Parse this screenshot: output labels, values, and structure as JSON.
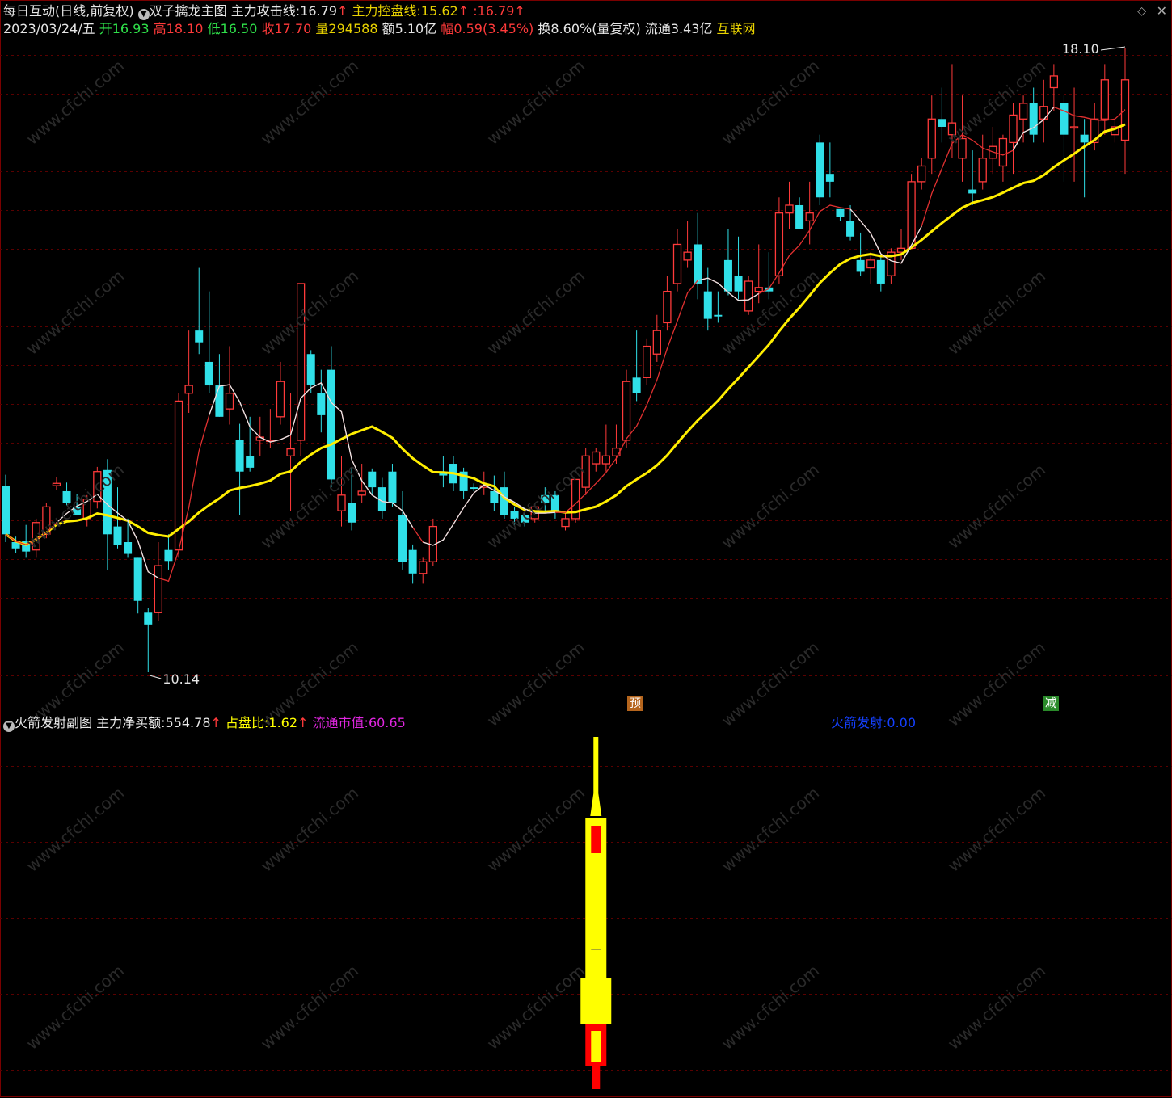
{
  "header": {
    "stock_name": "每日互动(日线,前复权)",
    "indicator_name": "双子擒龙主图",
    "attack_line_label": "主力攻击线:",
    "attack_line_value": "16.79",
    "control_line_label": "主力控盘线:",
    "control_line_value": "15.62",
    "third_prefix": ":",
    "third_value": "16.79",
    "up_arrow": "↑"
  },
  "quote": {
    "date": "2023/03/24/五",
    "open_label": "开",
    "open": "16.93",
    "high_label": "高",
    "high": "18.10",
    "low_label": "低",
    "low": "16.50",
    "close_label": "收",
    "close": "17.70",
    "vol_label": "量",
    "vol": "294588",
    "amount_label": "额",
    "amount": "5.10亿",
    "change_label": "幅",
    "change": "0.59(3.45%)",
    "turnover": "换8.60%(量复权)",
    "float": "流通3.43亿",
    "sector": "互联网"
  },
  "sub": {
    "title": "火箭发射副图",
    "net_buy_label": "主力净买额:",
    "net_buy_value": "554.78",
    "ratio_label": "占盘比:",
    "ratio_value": "1.62",
    "mcap_label": "流通市值:",
    "mcap_value": "60.65",
    "rocket_label": "火箭发射:",
    "rocket_value": "0.00",
    "up_arrow": "↑"
  },
  "markers": {
    "pre": "预",
    "reduce": "减"
  },
  "icons": {
    "settings": "circle-icon",
    "window": "diamond-icon",
    "close": "close-icon"
  },
  "colors": {
    "up": "#ff3a3a",
    "down": "#30e0e8",
    "ma_short": "#e03030",
    "ma_white": "#e8e8e8",
    "ma_yellow": "#ffee00",
    "grid": "#5a0000",
    "rocket_body": "#ffff00",
    "rocket_core": "#ff0000"
  },
  "chart_data": {
    "type": "candlestick",
    "price_range": [
      10.14,
      18.1
    ],
    "annotations": {
      "high_label": "18.10",
      "low_label": "10.14"
    },
    "candles": [
      [
        12.52,
        12.66,
        11.8,
        11.9
      ],
      [
        11.8,
        11.87,
        11.66,
        11.72
      ],
      [
        11.82,
        12.02,
        11.6,
        11.68
      ],
      [
        11.7,
        12.1,
        11.6,
        12.05
      ],
      [
        11.9,
        12.3,
        11.85,
        12.25
      ],
      [
        12.52,
        12.63,
        12.47,
        12.55
      ],
      [
        12.45,
        12.56,
        12.27,
        12.3
      ],
      [
        12.25,
        12.41,
        12.14,
        12.15
      ],
      [
        12.1,
        12.4,
        12.0,
        12.35
      ],
      [
        12.32,
        12.76,
        12.23,
        12.7
      ],
      [
        12.72,
        12.86,
        11.44,
        11.9
      ],
      [
        12.0,
        12.5,
        11.72,
        11.76
      ],
      [
        11.8,
        12.1,
        11.6,
        11.65
      ],
      [
        11.6,
        11.6,
        10.89,
        11.05
      ],
      [
        10.9,
        10.96,
        10.14,
        10.75
      ],
      [
        10.9,
        11.8,
        10.8,
        11.5
      ],
      [
        11.7,
        11.9,
        11.45,
        11.56
      ],
      [
        11.7,
        13.7,
        11.6,
        13.6
      ],
      [
        13.7,
        14.5,
        13.45,
        13.8
      ],
      [
        14.5,
        15.3,
        14.2,
        14.35
      ],
      [
        14.1,
        15.0,
        13.7,
        13.8
      ],
      [
        13.8,
        14.2,
        13.4,
        13.4
      ],
      [
        13.5,
        14.3,
        13.3,
        13.7
      ],
      [
        13.1,
        13.31,
        12.15,
        12.7
      ],
      [
        12.9,
        13.4,
        12.7,
        12.75
      ],
      [
        13.1,
        13.4,
        12.9,
        13.14
      ],
      [
        13.1,
        13.5,
        13.0,
        13.1
      ],
      [
        13.4,
        14.1,
        13.3,
        13.85
      ],
      [
        12.9,
        13.7,
        12.2,
        12.99
      ],
      [
        13.1,
        15.0,
        12.9,
        15.1
      ],
      [
        14.2,
        14.25,
        13.7,
        13.8
      ],
      [
        13.7,
        14.0,
        13.2,
        13.42
      ],
      [
        14.0,
        14.3,
        12.5,
        12.6
      ],
      [
        12.2,
        12.9,
        12.0,
        12.4
      ],
      [
        12.3,
        12.75,
        11.95,
        12.05
      ],
      [
        12.4,
        12.8,
        12.3,
        12.45
      ],
      [
        12.7,
        12.74,
        12.4,
        12.5
      ],
      [
        12.5,
        12.62,
        12.1,
        12.2
      ],
      [
        12.7,
        12.8,
        12.25,
        12.3
      ],
      [
        12.15,
        12.45,
        11.45,
        11.55
      ],
      [
        11.7,
        11.77,
        11.27,
        11.4
      ],
      [
        11.4,
        11.6,
        11.27,
        11.55
      ],
      [
        11.55,
        12.1,
        11.5,
        12.0
      ],
      [
        12.7,
        12.9,
        12.5,
        12.65
      ],
      [
        12.8,
        12.9,
        12.45,
        12.55
      ],
      [
        12.7,
        12.75,
        12.35,
        12.45
      ],
      [
        12.5,
        12.55,
        12.45,
        12.48
      ],
      [
        12.5,
        12.7,
        12.4,
        12.52
      ],
      [
        12.45,
        12.65,
        12.2,
        12.3
      ],
      [
        12.5,
        12.7,
        12.1,
        12.15
      ],
      [
        12.2,
        12.25,
        12.0,
        12.1
      ],
      [
        12.15,
        12.25,
        12.0,
        12.05
      ],
      [
        12.1,
        12.3,
        12.05,
        12.25
      ],
      [
        12.4,
        12.5,
        12.2,
        12.3
      ],
      [
        12.4,
        12.45,
        12.1,
        12.2
      ],
      [
        12.0,
        12.2,
        11.95,
        12.1
      ],
      [
        12.1,
        12.6,
        12.05,
        12.6
      ],
      [
        12.5,
        13.0,
        12.4,
        12.9
      ],
      [
        12.8,
        13.0,
        12.7,
        12.95
      ],
      [
        12.8,
        13.3,
        12.7,
        12.9
      ],
      [
        12.9,
        13.3,
        12.8,
        13.0
      ],
      [
        13.1,
        14.0,
        13.0,
        13.85
      ],
      [
        13.9,
        14.5,
        13.6,
        13.7
      ],
      [
        13.9,
        14.4,
        13.8,
        14.3
      ],
      [
        14.2,
        14.7,
        14.1,
        14.5
      ],
      [
        14.6,
        15.2,
        14.5,
        15.0
      ],
      [
        15.1,
        15.8,
        15.0,
        15.6
      ],
      [
        15.4,
        15.9,
        15.3,
        15.5
      ],
      [
        15.6,
        16.0,
        14.9,
        15.1
      ],
      [
        15.0,
        15.3,
        14.5,
        14.65
      ],
      [
        14.7,
        15.0,
        14.6,
        14.68
      ],
      [
        15.4,
        15.8,
        14.95,
        15.0
      ],
      [
        15.2,
        15.7,
        14.9,
        15.0
      ],
      [
        14.75,
        15.2,
        14.7,
        15.13
      ],
      [
        15.0,
        15.6,
        14.85,
        15.05
      ],
      [
        15.05,
        15.5,
        14.9,
        15.0
      ],
      [
        15.2,
        16.2,
        15.1,
        16.0
      ],
      [
        16.0,
        16.4,
        15.8,
        16.1
      ],
      [
        16.1,
        16.2,
        15.8,
        15.8
      ],
      [
        15.9,
        16.4,
        15.6,
        16.0
      ],
      [
        16.9,
        17.0,
        16.1,
        16.2
      ],
      [
        16.5,
        16.9,
        16.2,
        16.4
      ],
      [
        16.05,
        16.05,
        15.9,
        15.95
      ],
      [
        15.9,
        16.1,
        15.65,
        15.7
      ],
      [
        15.4,
        15.75,
        15.2,
        15.25
      ],
      [
        15.3,
        15.5,
        15.1,
        15.4
      ],
      [
        15.4,
        15.45,
        15.0,
        15.1
      ],
      [
        15.2,
        15.55,
        15.1,
        15.5
      ],
      [
        15.5,
        15.8,
        15.4,
        15.55
      ],
      [
        15.55,
        16.5,
        15.6,
        16.4
      ],
      [
        16.4,
        16.7,
        16.3,
        16.6
      ],
      [
        16.7,
        17.5,
        16.5,
        17.2
      ],
      [
        17.2,
        17.6,
        16.9,
        17.1
      ],
      [
        17.0,
        17.9,
        16.7,
        17.15
      ],
      [
        16.7,
        17.5,
        16.4,
        16.95
      ],
      [
        16.3,
        16.8,
        16.1,
        16.25
      ],
      [
        16.4,
        17.0,
        16.3,
        16.7
      ],
      [
        16.7,
        17.1,
        16.5,
        16.85
      ],
      [
        16.6,
        17.0,
        16.4,
        16.95
      ],
      [
        16.9,
        17.4,
        16.5,
        17.25
      ],
      [
        17.2,
        17.5,
        16.9,
        17.4
      ],
      [
        17.4,
        17.6,
        16.9,
        17.0
      ],
      [
        17.2,
        17.7,
        16.9,
        17.36
      ],
      [
        17.6,
        17.9,
        17.3,
        17.75
      ],
      [
        17.4,
        17.5,
        16.4,
        17.0
      ],
      [
        17.1,
        17.6,
        16.4,
        17.1
      ],
      [
        17.0,
        17.2,
        16.2,
        16.9
      ],
      [
        16.9,
        17.4,
        16.8,
        17.2
      ],
      [
        17.2,
        17.9,
        17.0,
        17.7
      ],
      [
        17.0,
        17.2,
        16.9,
        17.1
      ],
      [
        16.93,
        18.1,
        16.5,
        17.7
      ]
    ],
    "rocket": {
      "active_bar_index": 58
    }
  }
}
